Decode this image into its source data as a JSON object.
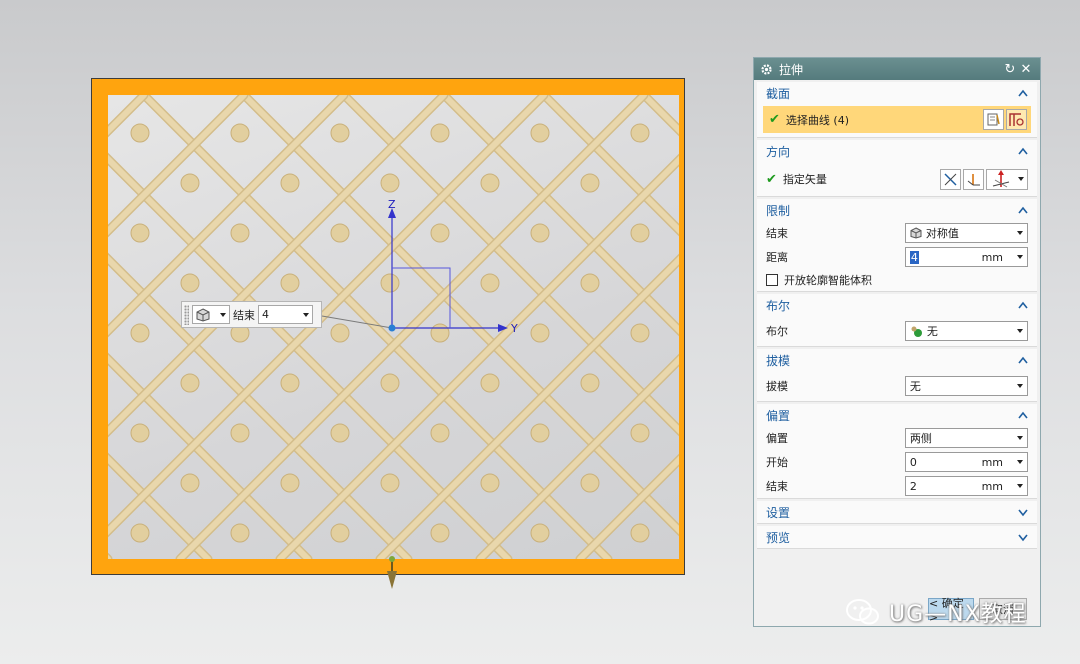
{
  "viewport": {
    "axis_z": "Z",
    "axis_y": "Y",
    "float_input": {
      "label": "结束",
      "value": "4"
    }
  },
  "dialog": {
    "title": "拉伸",
    "sections": {
      "section_profile": {
        "title": "截面",
        "select_curve": "选择曲线 (4)"
      },
      "direction": {
        "title": "方向",
        "specify_vector": "指定矢量"
      },
      "limits": {
        "title": "限制",
        "end_label": "结束",
        "end_value": "对称值",
        "distance_label": "距离",
        "distance_value": "4",
        "distance_unit": "mm",
        "open_profile_label": "开放轮廓智能体积",
        "open_profile_checked": false
      },
      "boolean": {
        "title": "布尔",
        "label": "布尔",
        "value": "无"
      },
      "draft": {
        "title": "拔模",
        "label": "拔模",
        "value": "无"
      },
      "offset": {
        "title": "偏置",
        "offset_label": "偏置",
        "offset_value": "两侧",
        "start_label": "开始",
        "start_value": "0",
        "start_unit": "mm",
        "end_label": "结束",
        "end_value": "2",
        "end_unit": "mm"
      },
      "settings": {
        "title": "设置"
      },
      "preview": {
        "title": "预览"
      }
    },
    "ok_label": "< 确定 >",
    "cancel_label": "取消"
  },
  "watermark": "UG—NX教程",
  "colors": {
    "frame_orange": "#ffa40e",
    "section_title_blue": "#1f5fa0",
    "titlebar": "#5f8587",
    "highlight_yellow": "#ffd77a",
    "lattice_rope": "#e9d7ac"
  },
  "icons": [
    "settings-gear-icon",
    "reset-icon",
    "close-icon",
    "check-icon",
    "chevron-up-icon",
    "chevron-down-icon",
    "curve-icon",
    "sketch-icon",
    "vector-icon",
    "solid-cube-icon",
    "boolean-none-icon",
    "wechat-icon"
  ]
}
